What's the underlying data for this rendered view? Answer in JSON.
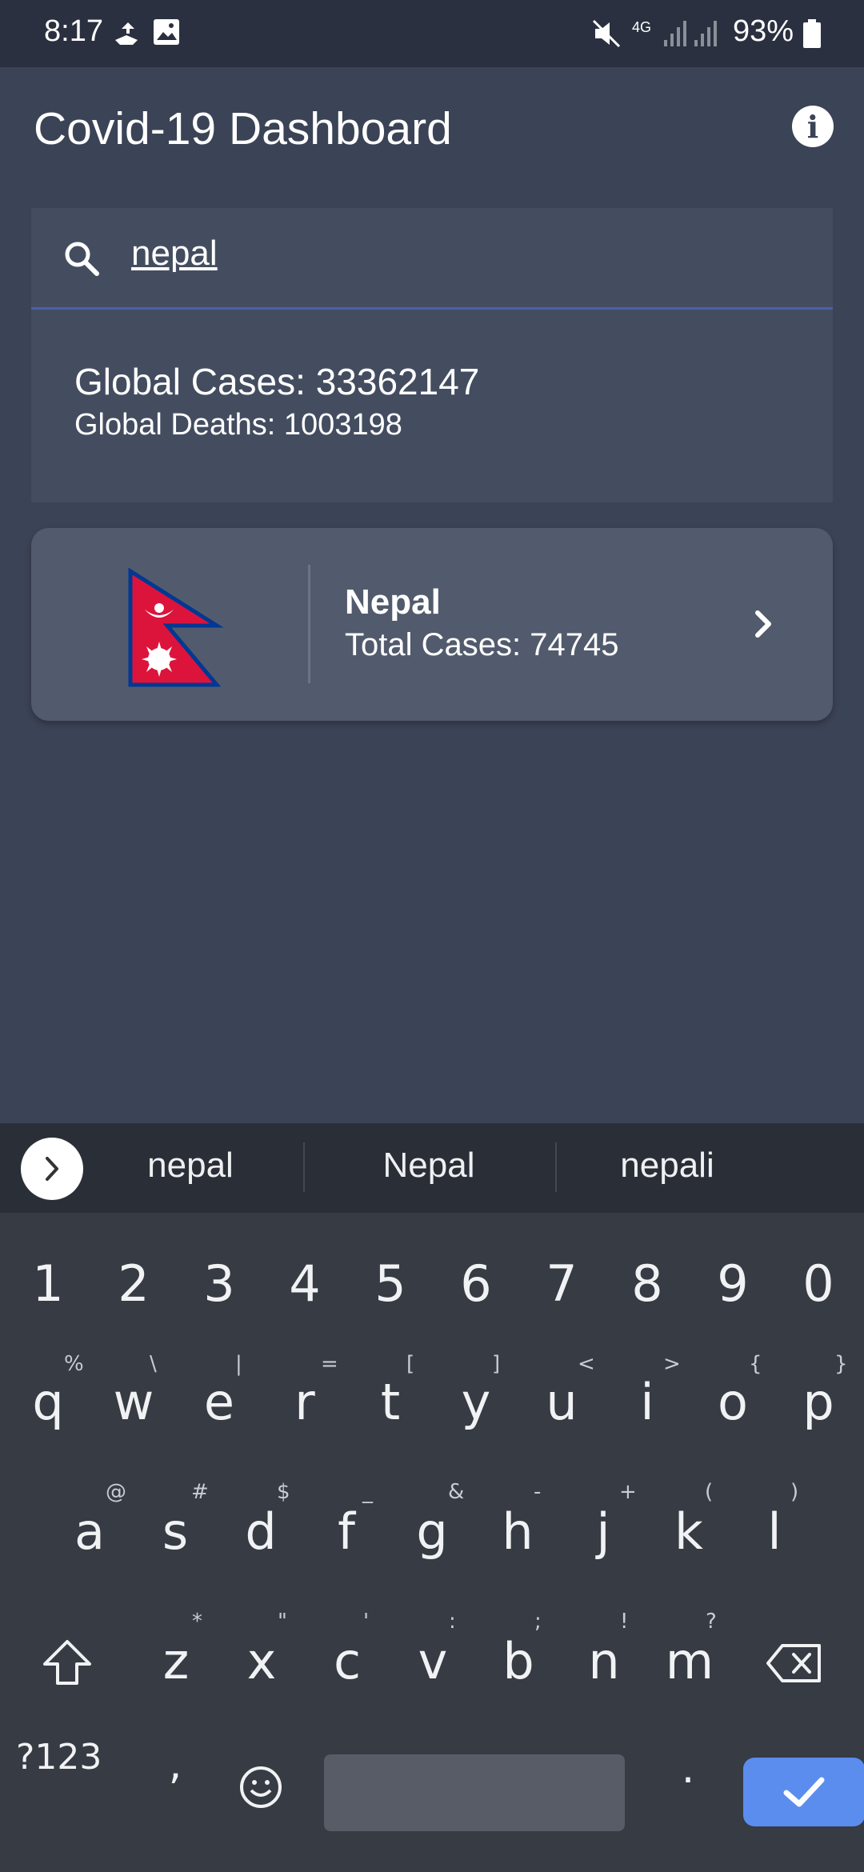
{
  "status_bar": {
    "time": "8:17",
    "battery": "93%",
    "network": "4G"
  },
  "app_bar": {
    "title": "Covid-19 Dashboard",
    "info_icon": "info-icon"
  },
  "search": {
    "value": "nepal",
    "icon": "search-icon",
    "accent_color": "#4a5fb0"
  },
  "global": {
    "cases": "Global Cases: 33362147",
    "deaths": "Global Deaths: 1003198"
  },
  "country_card": {
    "name": "Nepal",
    "total_cases": "Total Cases: 74745",
    "flag_icon": "nepal-flag-icon",
    "chevron_icon": "chevron-right-icon"
  },
  "suggestions": [
    "nepal",
    "Nepal",
    "nepali"
  ],
  "keyboard": {
    "number_row": [
      "1",
      "2",
      "3",
      "4",
      "5",
      "6",
      "7",
      "8",
      "9",
      "0"
    ],
    "row1": [
      "q",
      "w",
      "e",
      "r",
      "t",
      "y",
      "u",
      "i",
      "o",
      "p"
    ],
    "row1_hints": [
      "%",
      "\\",
      "|",
      "=",
      "[",
      "]",
      "<",
      ">",
      "{",
      "}"
    ],
    "row2": [
      "a",
      "s",
      "d",
      "f",
      "g",
      "h",
      "j",
      "k",
      "l"
    ],
    "row2_hints": [
      "@",
      "#",
      "$",
      "_",
      "&",
      "-",
      "+",
      "(",
      ")"
    ],
    "row3": [
      "z",
      "x",
      "c",
      "v",
      "b",
      "n",
      "m"
    ],
    "row3_hints": [
      "*",
      "\"",
      "'",
      ":",
      ";",
      "!",
      "?"
    ],
    "symbols_label": "?123",
    "comma": ",",
    "period": "."
  }
}
